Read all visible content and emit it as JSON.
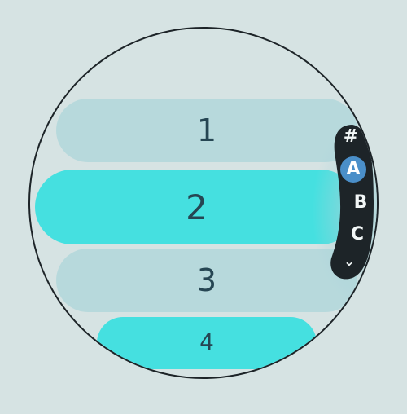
{
  "list": {
    "items": [
      {
        "label": "1"
      },
      {
        "label": "2"
      },
      {
        "label": "3"
      },
      {
        "label": "4"
      }
    ]
  },
  "index_bar": {
    "letters": [
      "#",
      "A",
      "B",
      "C"
    ],
    "selected": "A",
    "scroll_down_glyph": "⌄"
  },
  "colors": {
    "background": "#d6e3e3",
    "item_dim": "#b7d9dc",
    "item_active": "#45e0e0",
    "index_bar": "#1d2428",
    "index_selected": "#4a8fc9",
    "text": "#264653"
  }
}
